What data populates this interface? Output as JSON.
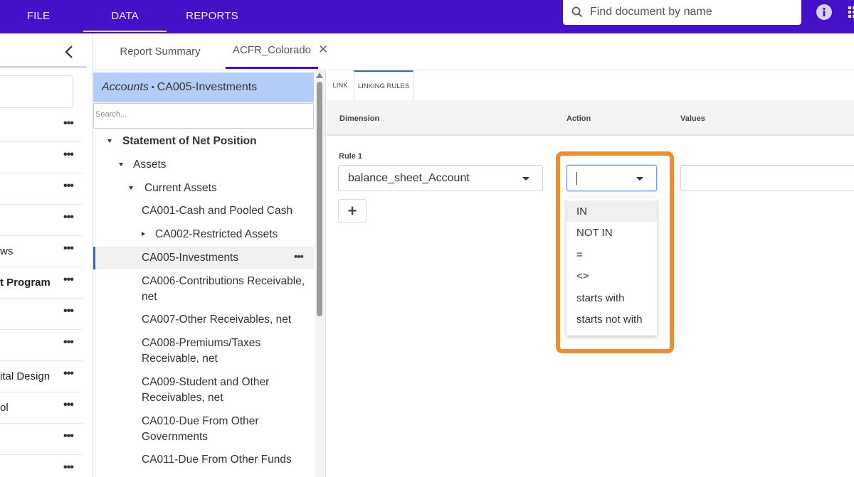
{
  "topbar": {
    "menu": [
      "FILE",
      "DATA",
      "REPORTS"
    ],
    "search_placeholder": "Find document by name",
    "accent_color": "#4410c8"
  },
  "leftnav": {
    "items": [
      "",
      "",
      "",
      "",
      "ws",
      "t Program",
      "",
      "",
      "ital Design",
      "ol",
      "",
      ""
    ]
  },
  "tabs": {
    "summary": "Report Summary",
    "document": "ACFR_Colorado"
  },
  "tree": {
    "crumb_prefix": "Accounts",
    "crumb_sep": "•",
    "crumb_value": "CA005-Investments",
    "search_placeholder": "Search...",
    "nodes": [
      "Statement of Net Position",
      "Assets",
      "Current Assets",
      "CA001-Cash and Pooled Cash",
      "CA002-Restricted Assets",
      "CA005-Investments",
      "CA006-Contributions Receivable,",
      "net",
      "CA007-Other Receivables, net",
      "CA008-Premiums/Taxes",
      "Receivable, net",
      "CA009-Student and Other",
      "Receivables, net",
      "CA010-Due From Other",
      "Governments",
      "CA011-Due From Other Funds"
    ]
  },
  "editor": {
    "tabs": [
      "LINK",
      "LINKING RULES"
    ],
    "columns": [
      "Dimension",
      "Action",
      "Values"
    ],
    "rule_label": "Rule 1",
    "dimension_value": "balance_sheet_Account",
    "action_value": "",
    "values_value": "",
    "add_label": "+",
    "action_options": [
      "IN",
      "NOT IN",
      "=",
      "<>",
      "starts with",
      "starts not with"
    ]
  },
  "colors": {
    "highlight": "#ef8c2c",
    "selected_crumb": "#b4cdf6",
    "selection_bar": "#1a6fd1"
  }
}
